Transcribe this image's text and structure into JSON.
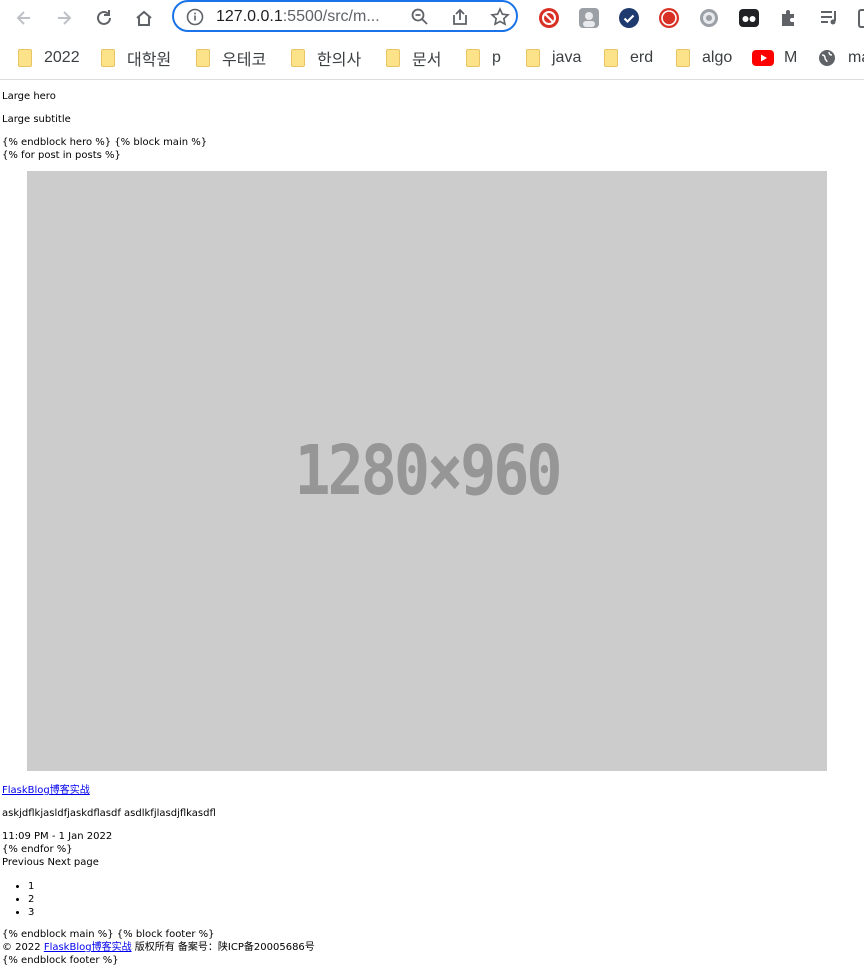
{
  "browser": {
    "url_host": "127.0.0.1",
    "url_rest": ":5500/src/m...",
    "bookmarks": [
      "2022",
      "대학원",
      "우테코",
      "한의사",
      "문서",
      "p",
      "java",
      "erd",
      "algo",
      "M",
      "ma"
    ]
  },
  "page": {
    "hero_title": "Large hero",
    "hero_subtitle": "Large subtitle",
    "template_line_1": "{% endblock hero %} {% block main %}",
    "template_line_2": "{% for post in posts %}",
    "image_placeholder": "1280×960",
    "post_title": "FlaskBlog博客实战",
    "post_body": "askjdflkjasldfjaskdflasdf asdlkfjlasdjflkasdfl",
    "post_time": "11:09 PM - 1 Jan 2022",
    "endfor": "{% endfor %}",
    "pager_text": "Previous Next page",
    "pages": [
      "1",
      "2",
      "3"
    ],
    "template_line_3": "{% endblock main %} {% block footer %}",
    "footer_prefix": "© 2022 ",
    "footer_link": "FlaskBlog博客实战",
    "footer_suffix": " 版权所有 备案号：陕ICP备20005686号",
    "template_line_4": "{% endblock footer %}"
  }
}
